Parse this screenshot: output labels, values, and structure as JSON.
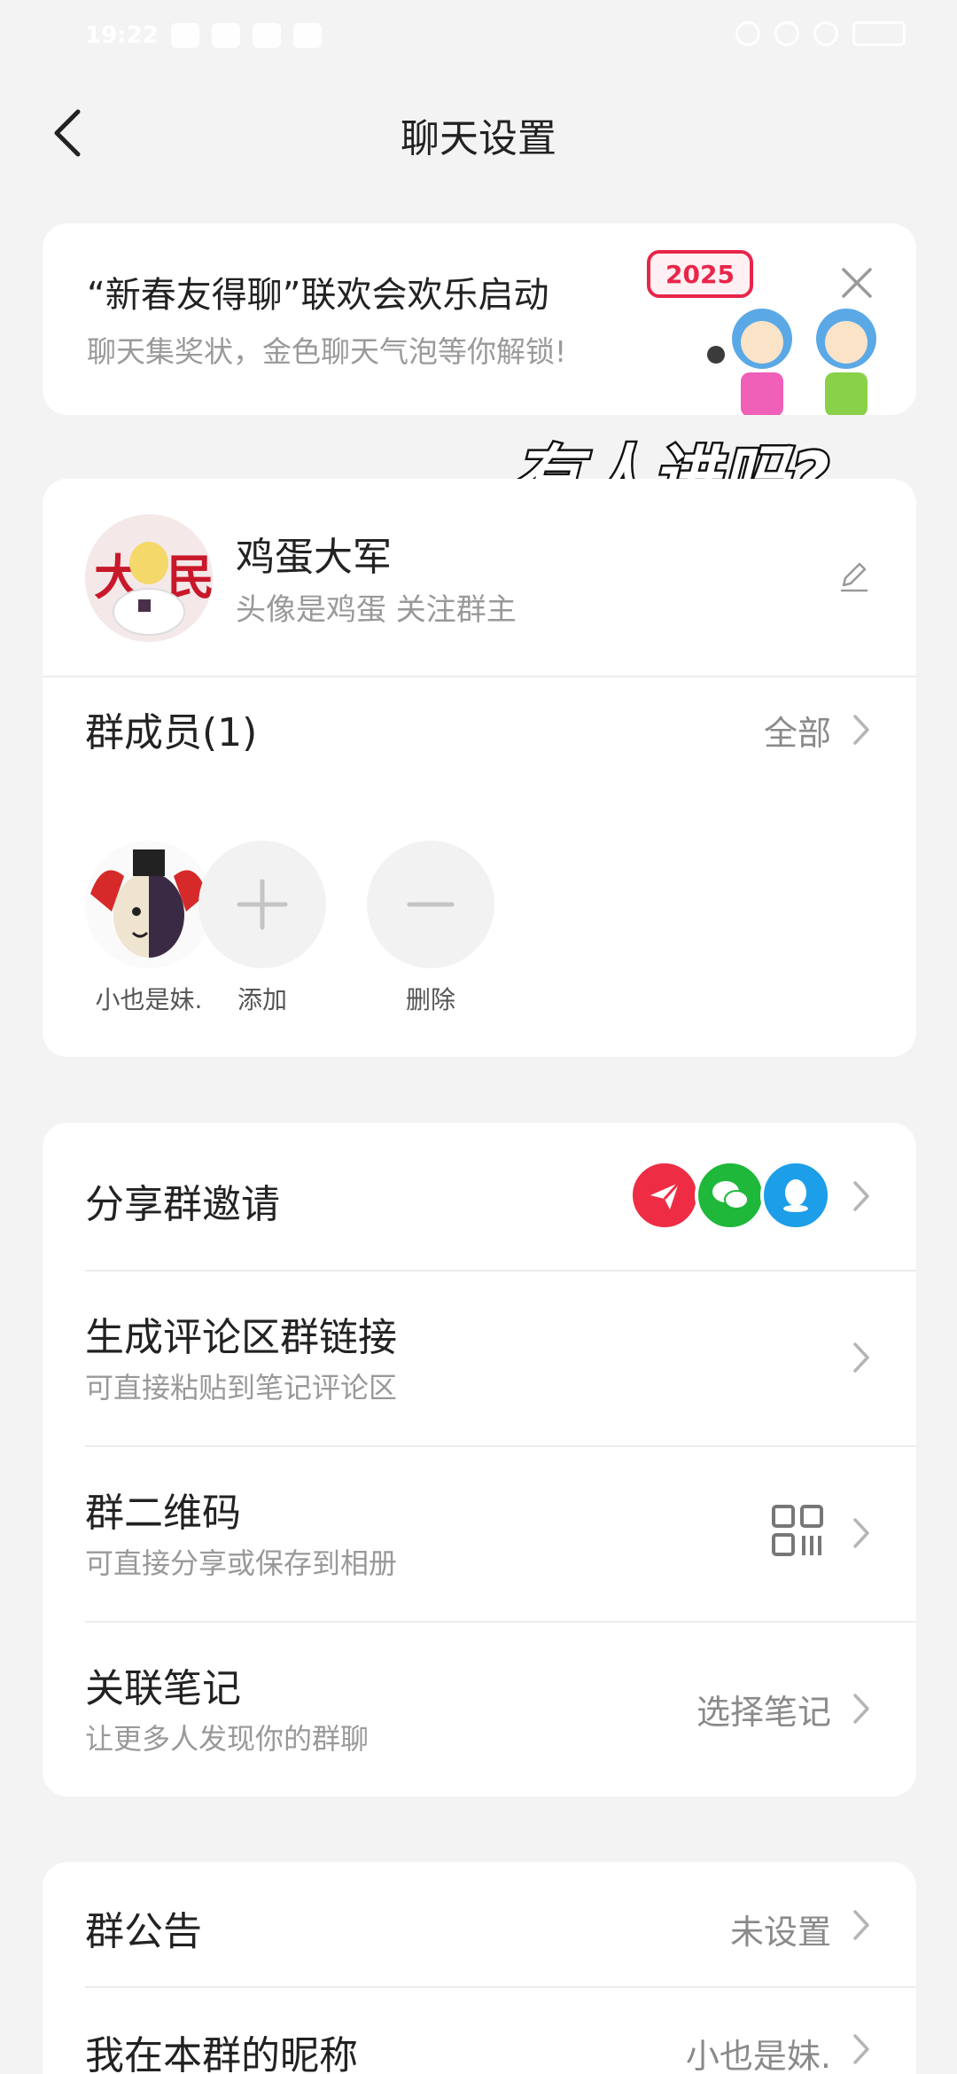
{
  "status_bar": {
    "time": "19:22"
  },
  "nav": {
    "title": "聊天设置"
  },
  "promo": {
    "title": "“新春友得聊”联欢会欢乐启动",
    "subtitle": "聊天集奖状，金色聊天气泡等你解锁!",
    "badge": "2025"
  },
  "overlay_caption": "有人进吗?",
  "group": {
    "name": "鸡蛋大军",
    "description": "头像是鸡蛋 关注群主",
    "members_label": "群成员(1)",
    "members_all": "全部",
    "members": [
      {
        "label": "小也是妹."
      },
      {
        "label": "添加"
      },
      {
        "label": "删除"
      }
    ]
  },
  "share": {
    "invite_label": "分享群邀请",
    "link_title": "生成评论区群链接",
    "link_sub": "可直接粘贴到笔记评论区",
    "qr_title": "群二维码",
    "qr_sub": "可直接分享或保存到相册",
    "note_title": "关联笔记",
    "note_sub": "让更多人发现你的群聊",
    "note_action": "选择笔记",
    "icons": [
      "send-icon",
      "wechat-icon",
      "qq-icon"
    ],
    "colors": {
      "send": "#ee2d45",
      "wechat": "#1fb83a",
      "qq": "#1c9ee8"
    }
  },
  "notice": {
    "announcement_label": "群公告",
    "announcement_value": "未设置",
    "nickname_label": "我在本群的昵称",
    "nickname_value": "小也是妹."
  }
}
